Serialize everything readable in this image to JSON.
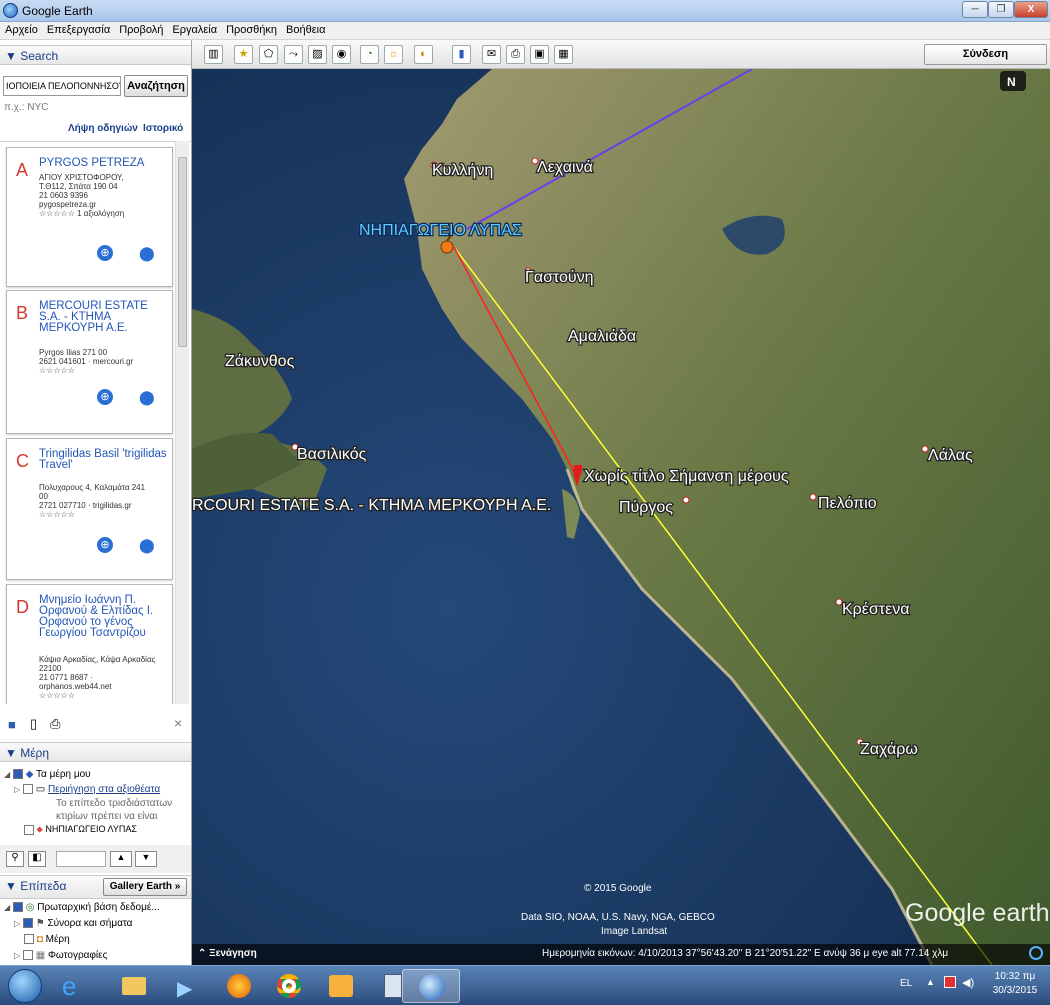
{
  "window": {
    "title": "Google Earth",
    "minimize": "─",
    "maximize": "❐",
    "close": "X"
  },
  "menu": [
    "Αρχείο",
    "Επεξεργασία",
    "Προβολή",
    "Εργαλεία",
    "Προσθήκη",
    "Βοήθεια"
  ],
  "toolbar": {
    "sign_in": "Σύνδεση"
  },
  "search": {
    "header": "▼ Search",
    "query": "ΙΟΠΟΙΕΙΑ ΠΕΛΟΠΟΝΝΗΣΟΥ",
    "button": "Αναζήτηση",
    "hint": "π.χ.: NYC",
    "directions_link": "Λήψη οδηγιών",
    "history_link": "Ιστορικό"
  },
  "results": [
    {
      "letter": "A",
      "name": "PYRGOS PETREZA",
      "lines": [
        "ΑΓΙΟΥ ΧΡΙΣΤΟΦΟΡΟΥ,",
        "Τ.Θ112, Σπάτα 190 04",
        "21 0603 9396",
        "pygospetreza.gr",
        "☆☆☆☆☆ 1 αξιολόγηση"
      ]
    },
    {
      "letter": "B",
      "name": "MERCOURI ESTATE S.A. - ΚΤΗΜΑ ΜΕΡΚΟΥΡΗ Α.Ε.",
      "lines": [
        "Pyrgos Ilias 271 00",
        "2621 041601 · mercouri.gr",
        "☆☆☆☆☆"
      ]
    },
    {
      "letter": "C",
      "name": "Tringilidas Basil 'trigilidas Travel'",
      "lines": [
        "Πολυχαρους 4, Καλαμάτα 241",
        "00",
        "2721 027710 · trigilidas.gr",
        "☆☆☆☆☆"
      ]
    },
    {
      "letter": "D",
      "name": "Μνημείο Ιωάννη Π. Ορφανού & Ελπίδας Ι. Ορφανού το γένος Γεωργίου Τσαντρίζου",
      "lines": [
        "Κάψια Αρκαδίας, Κάψα Αρκαδίας",
        "22100",
        "21 0771 8687 ·",
        "orphanos.web44.net",
        "☆☆☆☆☆"
      ]
    }
  ],
  "places": {
    "header": "▼ Μέρη",
    "items": [
      {
        "label": "Τα μέρη μου"
      },
      {
        "label": "Περιήγηση στα αξιοθέατα"
      },
      {
        "label": "Το επίπεδο τρισδιάστατων"
      },
      {
        "label": "κτιρίων πρέπει να είναι"
      },
      {
        "label": "ΝΗΠΙΑΓΩΓΕΙΟ ΛΥΠΑΣ"
      }
    ]
  },
  "layers": {
    "header": "▼ Επίπεδα",
    "gallery_button": "Gallery Earth »",
    "items": [
      "Πρωταρχική βάση δεδομέ...",
      "Σύνορα και σήματα",
      "Μέρη",
      "Φωτογραφίες"
    ]
  },
  "map": {
    "places": [
      "Κυλλήνη",
      "Λεχαινά",
      "Γαστούνη",
      "Αμαλιάδα",
      "Ζάκυνθος",
      "Βασιλικός",
      "Πύργος",
      "Πελόπιο",
      "Λάλας",
      "Κρέστενα",
      "Ζαχάρω"
    ],
    "placemarks": [
      "ΝΗΠΙΑΓΩΓΕΙΟ ΛΥΠΑΣ",
      "Χωρίς τίτλο Σήμανση μέρους",
      "RCOURI ESTATE S.A. - ΚΤΗΜΑ ΜΕΡΚΟΥΡΗ Α.Ε."
    ],
    "compass": "N",
    "copyright": "© 2015 Google",
    "data_credits": "Data SIO, NOAA, U.S. Navy, NGA, GEBCO",
    "imagery": "Image Landsat",
    "logo": "Google earth",
    "tour": "Ξενάγηση",
    "status": "Ημερομηνία εικόνων: 4/10/2013    37°56'43.20\" Β   21°20'51.22\" Ε  ανύψ   36 μ    eye alt  77.14 χλμ"
  },
  "taskbar": {
    "language": "EL",
    "time": "10:32 πμ",
    "date": "30/3/2015"
  }
}
